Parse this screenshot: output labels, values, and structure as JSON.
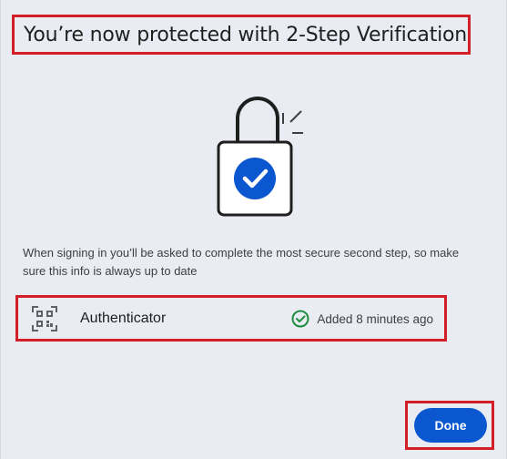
{
  "dialog": {
    "title": "You’re now protected with 2-Step Verification",
    "description": "When signing in you’ll be asked to complete the most secure second step, so make sure this info is always up to date",
    "method": {
      "icon": "qr-code-icon",
      "name": "Authenticator",
      "status_icon": "check-circle-icon",
      "status": "Added 8 minutes ago"
    },
    "done_label": "Done"
  },
  "colors": {
    "accent": "#0b57d0",
    "success": "#1e8e3e",
    "highlight": "#d32027",
    "background": "#e9ecf3"
  }
}
